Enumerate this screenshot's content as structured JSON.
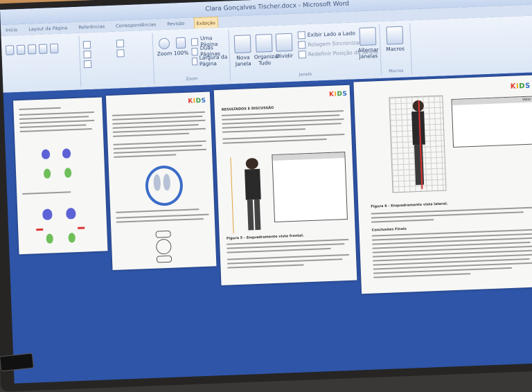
{
  "window": {
    "title": "Clara Gonçalves Tischer.docx - Microsoft Word"
  },
  "tabs": [
    {
      "label": "Início"
    },
    {
      "label": "Layout da Página"
    },
    {
      "label": "Referências"
    },
    {
      "label": "Correspondências"
    },
    {
      "label": "Revisão"
    },
    {
      "label": "Exibição",
      "active": true
    }
  ],
  "ribbon": {
    "zoom_group": {
      "label": "Zoom",
      "zoom_label": "Zoom",
      "hundred_label": "100%",
      "one_page": "Uma Página",
      "two_pages": "Duas Páginas",
      "page_width": "Largura da Página"
    },
    "window_group": {
      "label": "Janela",
      "new_window": "Nova Janela",
      "arrange_all": "Organizar Tudo",
      "split": "Dividir",
      "side_by_side": "Exibir Lado a Lado",
      "sync_scroll": "Rolagem Sincronizada",
      "reset_position": "Redefinir Posição da Janela",
      "switch_windows": "Alternar Janelas"
    },
    "macros_group": {
      "label": "Macros",
      "macros": "Macros"
    }
  },
  "pages": {
    "p3": {
      "heading": "RESULTADOS E DISCUSSÃO",
      "caption": "Figura 5 - Enquadramento vista frontal."
    },
    "p4": {
      "caption": "Figura 6 - Enquadramento vista lateral.",
      "subheading": "Conclusões Finais",
      "table_header": "Valor"
    }
  },
  "brand": {
    "kids": [
      "K",
      "I",
      "D",
      "S"
    ]
  }
}
